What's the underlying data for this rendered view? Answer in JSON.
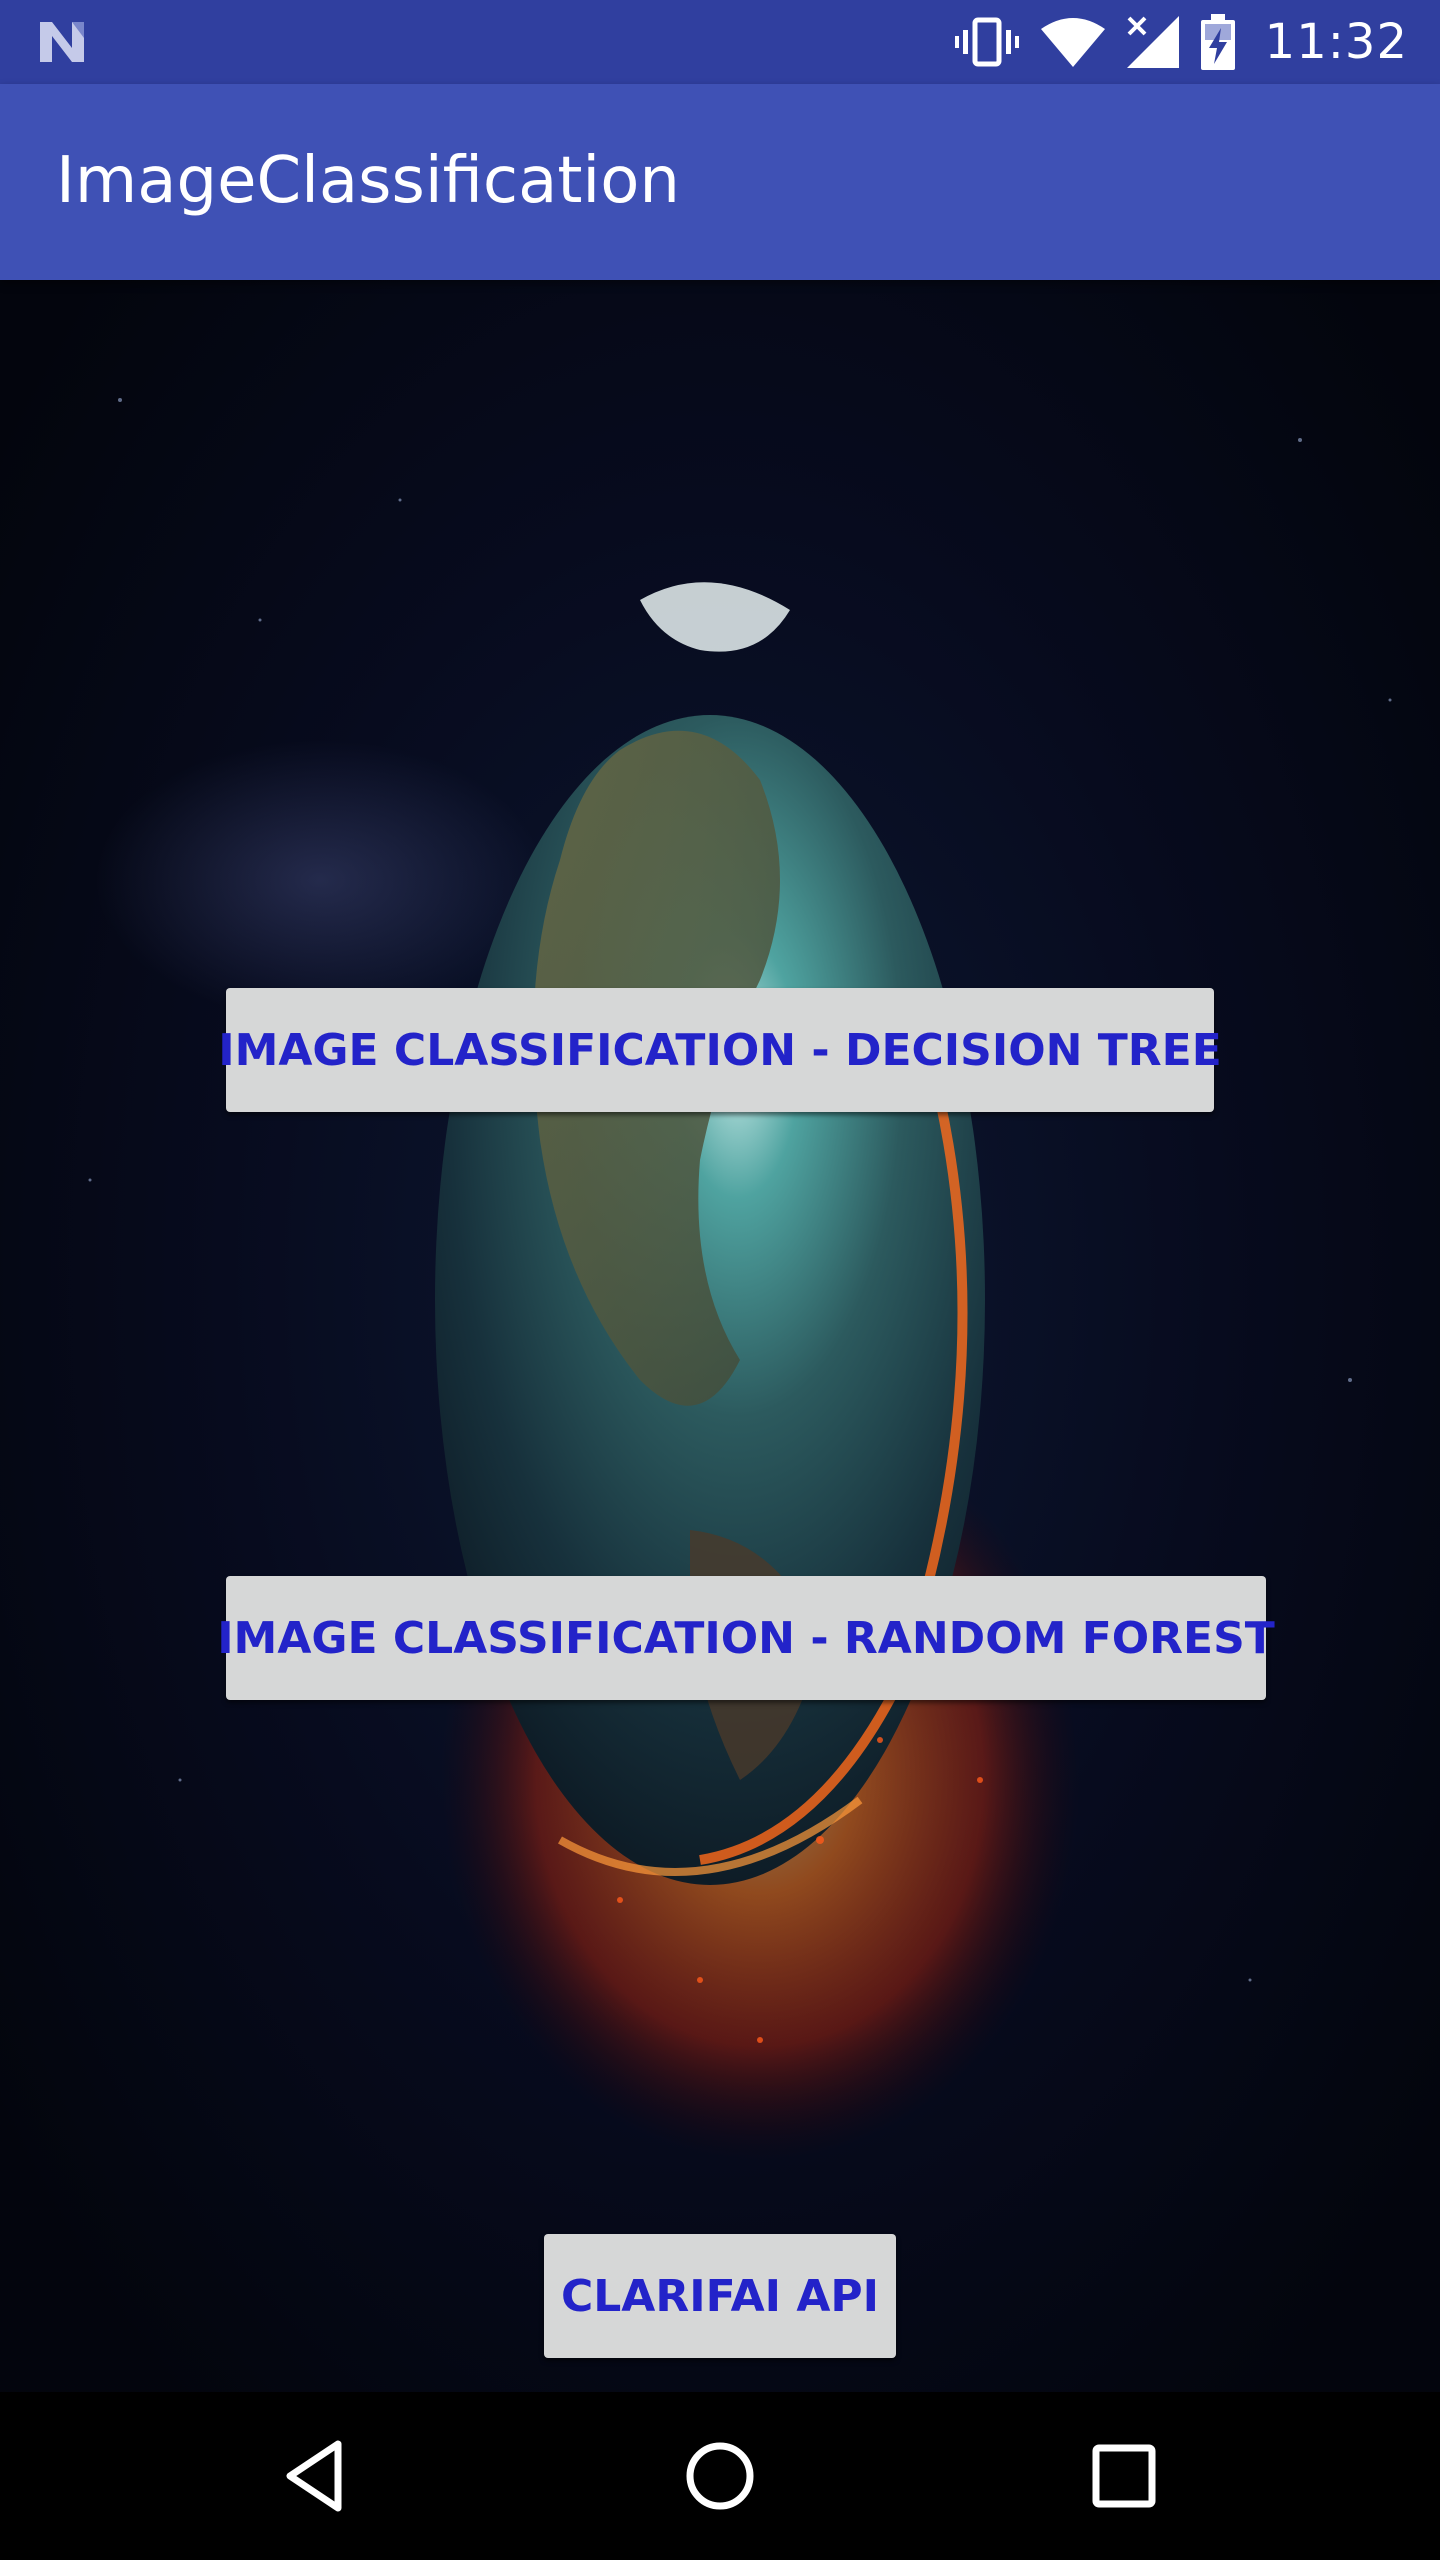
{
  "status_bar": {
    "time": "11:32",
    "icons": [
      "n-logo-icon",
      "vibrate-icon",
      "wifi-icon",
      "cell-signal-icon",
      "battery-charging-icon"
    ]
  },
  "app_bar": {
    "title": "ImageClassification",
    "color": "#3f51b5",
    "status_color": "#303f9f"
  },
  "buttons": {
    "decision_tree": "IMAGE CLASSIFICATION - DECISION TREE",
    "random_forest": "IMAGE CLASSIFICATION - RANDOM FOREST",
    "clarifai": "CLARIFAI API"
  },
  "button_style": {
    "background": "#d6d7d7",
    "text_color": "#2323c9"
  },
  "background_image": {
    "subject": "earth-globe-in-space"
  },
  "nav_bar": {
    "icons": [
      "back-icon",
      "home-icon",
      "recents-icon"
    ]
  }
}
